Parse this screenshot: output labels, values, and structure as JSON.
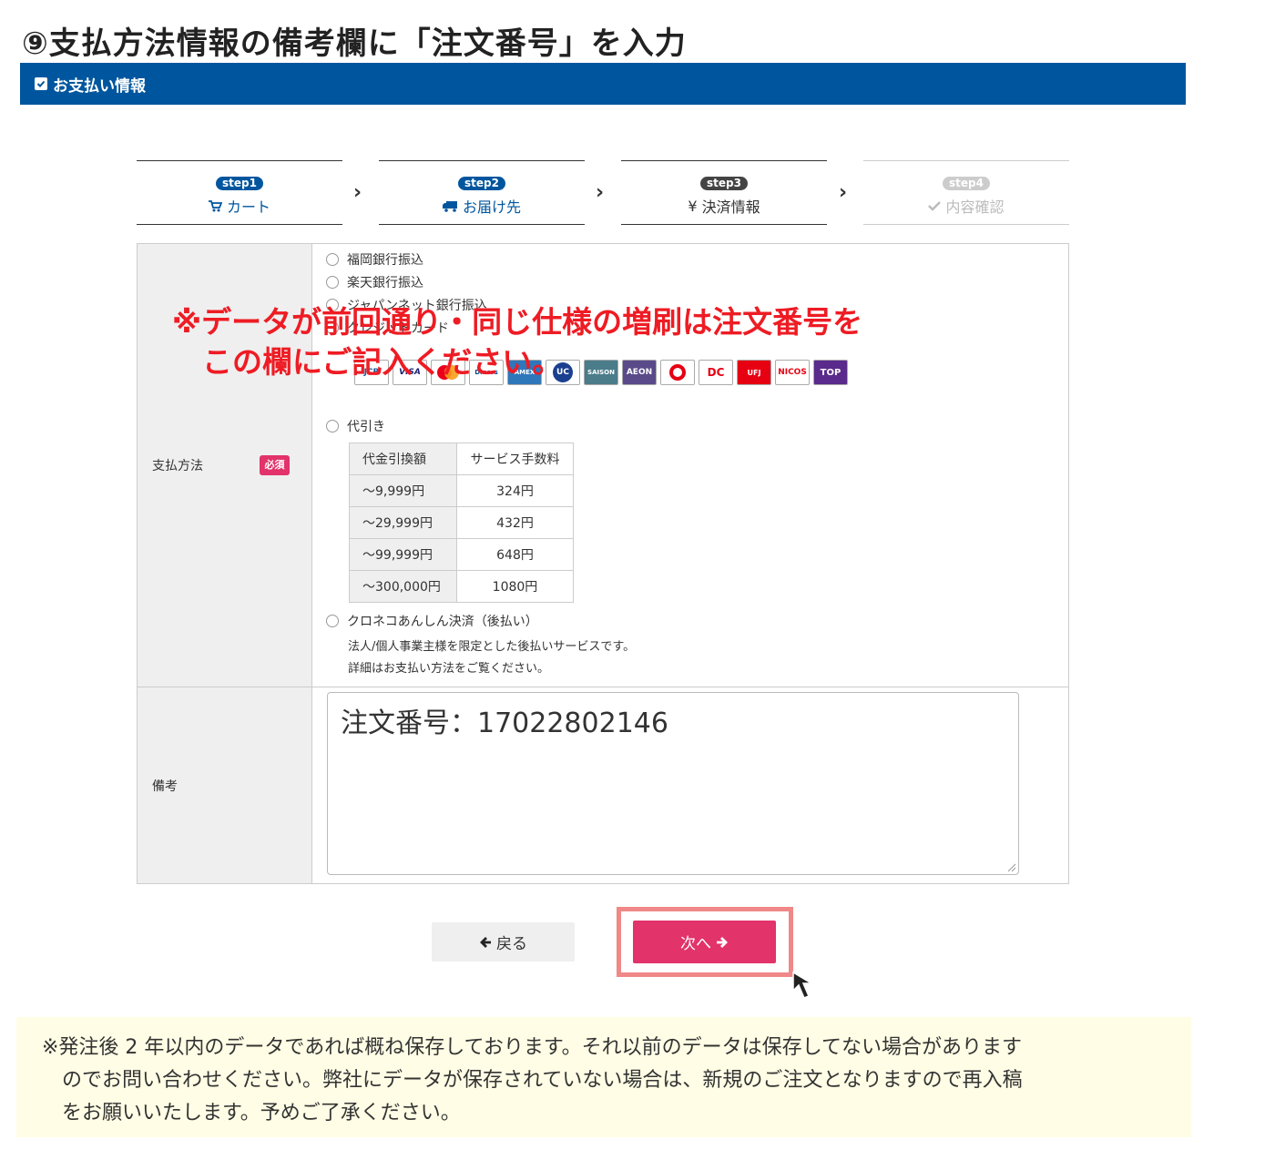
{
  "heading": "⑨支払方法情報の備考欄に「注文番号」を入力",
  "section_title": "お支払い情報",
  "steps": [
    {
      "badge": "step1",
      "label": "カート",
      "icon": "cart-icon"
    },
    {
      "badge": "step2",
      "label": "お届け先",
      "icon": "truck-icon"
    },
    {
      "badge": "step3",
      "label": "決済情報",
      "icon": "yen-icon"
    },
    {
      "badge": "step4",
      "label": "内容確認",
      "icon": "check-icon"
    }
  ],
  "payment": {
    "label": "支払方法",
    "required": "必須",
    "options": [
      "福岡銀行振込",
      "楽天銀行振込",
      "ジャパンネット銀行振込",
      "クレジットカード",
      "代引き",
      "クロネコあんしん決済（後払い）"
    ],
    "card_brands": [
      "JCB",
      "VISA",
      "MasterCard",
      "Diners Club",
      "American Express",
      "UC",
      "Saison Card",
      "AEON",
      "MUFG",
      "DC",
      "UFJ",
      "NICOS",
      "TOKYU CARD TOP"
    ],
    "fee_table": {
      "headers": [
        "代金引換額",
        "サービス手数料"
      ],
      "rows": [
        [
          "〜9,999円",
          "324円"
        ],
        [
          "〜29,999円",
          "432円"
        ],
        [
          "〜99,999円",
          "648円"
        ],
        [
          "〜300,000円",
          "1080円"
        ]
      ]
    },
    "kuroneko_notes": [
      "法人/個人事業主様を限定とした後払いサービスです。",
      "詳細はお支払い方法をご覧ください。"
    ]
  },
  "remarks": {
    "label": "備考",
    "value": "注文番号：17022802146",
    "annotation": "※データが前回通り・同じ仕様の増刷は注文番号を\n　この欄にご記入ください。"
  },
  "buttons": {
    "back": "戻る",
    "next": "次へ"
  },
  "notice": "※発注後 2 年以内のデータであれば概ね保存しております。それ以前のデータは保存してない場合があります\n　のでお問い合わせください。弊社にデータが保存されていない場合は、新規のご注文となりますので再入稿\n　をお願いいたします。予めご了承ください。",
  "colors": {
    "header": "#00569e",
    "accent": "#e2336b",
    "annotation_red": "#ee1c24",
    "highlight": "#f08888",
    "notice_bg": "#fffde5"
  }
}
